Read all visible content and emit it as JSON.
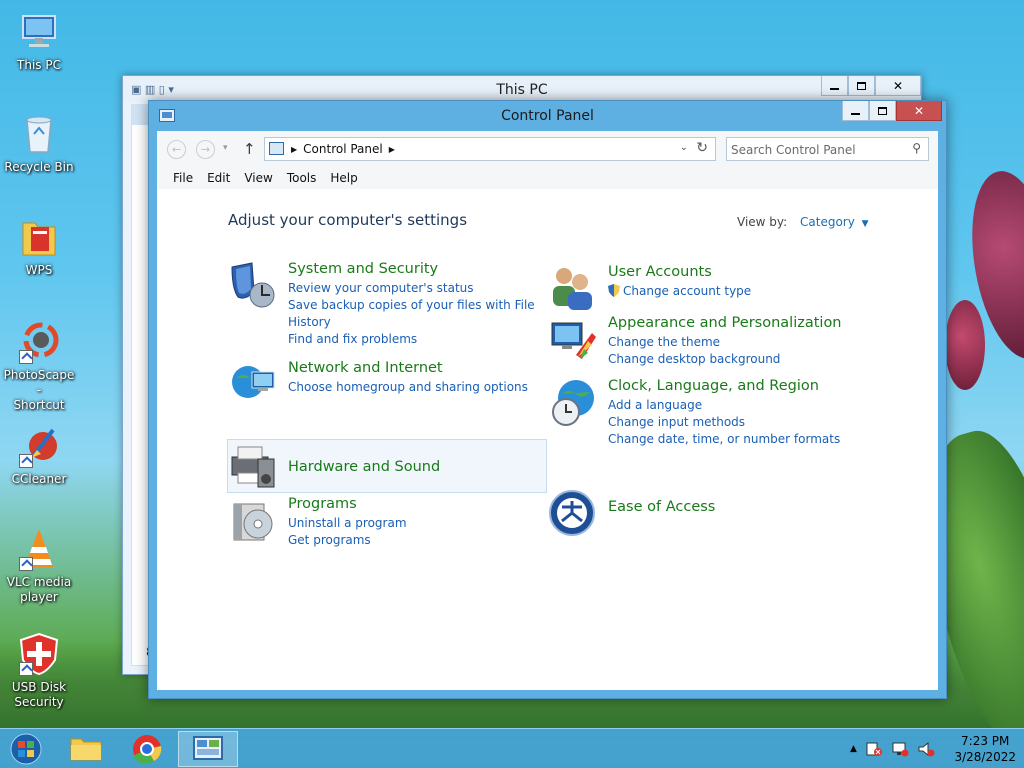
{
  "desktop": {
    "icons": [
      {
        "label_1": "This PC",
        "label_2": "",
        "icon": "computer-icon"
      },
      {
        "label_1": "Recycle Bin",
        "label_2": "",
        "icon": "recycle-bin-icon"
      },
      {
        "label_1": "WPS",
        "label_2": "",
        "icon": "folder-icon"
      },
      {
        "label_1": "PhotoScape -",
        "label_2": "Shortcut",
        "icon": "photoscape-icon"
      },
      {
        "label_1": "CCleaner",
        "label_2": "",
        "icon": "ccleaner-icon"
      },
      {
        "label_1": "VLC media",
        "label_2": "player",
        "icon": "vlc-icon"
      },
      {
        "label_1": "USB Disk",
        "label_2": "Security",
        "icon": "usb-disk-security-icon"
      }
    ]
  },
  "back_window": {
    "title": "This PC",
    "bottom_text": "8"
  },
  "window": {
    "title": "Control Panel",
    "address": {
      "crumb": "Control Panel"
    },
    "search": {
      "placeholder": "Search Control Panel"
    },
    "menu": [
      "File",
      "Edit",
      "View",
      "Tools",
      "Help"
    ],
    "heading": "Adjust your computer's settings",
    "view_by": {
      "label": "View by:",
      "value": "Category"
    },
    "categories": {
      "system_security": {
        "title": "System and Security",
        "links": [
          "Review your computer's status",
          "Save backup copies of your files with File",
          "History",
          "Find and fix problems"
        ]
      },
      "network": {
        "title": "Network and Internet",
        "links": [
          "Choose homegroup and sharing options"
        ]
      },
      "hardware": {
        "title": "Hardware and Sound",
        "links": []
      },
      "programs": {
        "title": "Programs",
        "links": [
          "Uninstall a program",
          "Get programs"
        ]
      },
      "user_accounts": {
        "title": "User Accounts",
        "links": [
          "Change account type"
        ]
      },
      "appearance": {
        "title": "Appearance and Personalization",
        "links": [
          "Change the theme",
          "Change desktop background"
        ]
      },
      "clock": {
        "title": "Clock, Language, and Region",
        "links": [
          "Add a language",
          "Change input methods",
          "Change date, time, or number formats"
        ]
      },
      "ease": {
        "title": "Ease of Access",
        "links": []
      }
    }
  },
  "taskbar": {
    "pinned": [
      "file-explorer-icon",
      "chrome-icon",
      "control-panel-icon"
    ],
    "clock": {
      "time": "7:23 PM",
      "date": "3/28/2022"
    }
  }
}
